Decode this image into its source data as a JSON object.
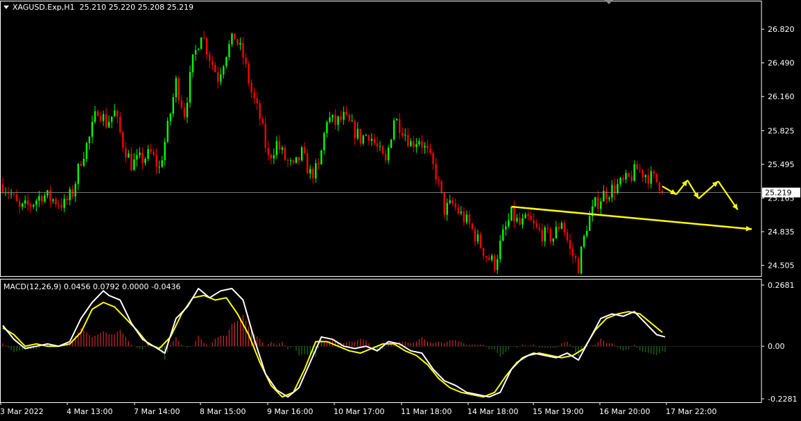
{
  "window": {
    "chart_title": "XAGUSD.Exp,H1",
    "ohlc": "25.210 25.220 25.208 25.219",
    "current_price": "25.219"
  },
  "indicator": {
    "label": "MACD(12,26,9) 0.0456 0.0792 0.0000 -0.0436"
  },
  "colors": {
    "background": "#000000",
    "bull_candle": "#00ff00",
    "bear_candle": "#ff0000",
    "grid_border": "#ffffff",
    "annotation": "#ffff00",
    "macd_line": "#ffffff",
    "signal_line": "#ffff00"
  },
  "chart_data": [
    {
      "type": "candlestick",
      "price_axis_ticks": [
        "26.820",
        "26.490",
        "26.160",
        "25.825",
        "25.495",
        "25.165",
        "24.835",
        "24.505"
      ],
      "time_axis_ticks": [
        "3 Mar 2022",
        "4 Mar 13:00",
        "7 Mar 14:00",
        "8 Mar 15:00",
        "9 Mar 16:00",
        "10 Mar 17:00",
        "11 Mar 18:00",
        "14 Mar 18:00",
        "15 Mar 19:00",
        "16 Mar 20:00",
        "17 Mar 22:00"
      ],
      "current_price": 25.219,
      "ylim": [
        24.4,
        27.1
      ],
      "close_path": [
        [
          0,
          25.3
        ],
        [
          3,
          25.2
        ],
        [
          6,
          25.05
        ],
        [
          10,
          25.1
        ],
        [
          14,
          25.2
        ],
        [
          18,
          25.15
        ],
        [
          22,
          25.1
        ],
        [
          25,
          25.22
        ],
        [
          28,
          25.55
        ],
        [
          31,
          25.75
        ],
        [
          34,
          26.05
        ],
        [
          37,
          25.9
        ],
        [
          40,
          26.0
        ],
        [
          43,
          25.7
        ],
        [
          46,
          25.5
        ],
        [
          50,
          25.55
        ],
        [
          53,
          25.6
        ],
        [
          56,
          25.45
        ],
        [
          59,
          25.85
        ],
        [
          62,
          26.3
        ],
        [
          65,
          26.0
        ],
        [
          68,
          26.5
        ],
        [
          71,
          26.8
        ],
        [
          74,
          26.55
        ],
        [
          77,
          26.35
        ],
        [
          80,
          26.6
        ],
        [
          83,
          26.75
        ],
        [
          86,
          26.55
        ],
        [
          89,
          26.2
        ],
        [
          92,
          25.95
        ],
        [
          95,
          25.55
        ],
        [
          98,
          25.7
        ],
        [
          101,
          25.55
        ],
        [
          104,
          25.45
        ],
        [
          107,
          25.6
        ],
        [
          110,
          25.4
        ],
        [
          113,
          25.45
        ],
        [
          116,
          25.95
        ],
        [
          119,
          25.9
        ],
        [
          122,
          25.95
        ],
        [
          125,
          25.85
        ],
        [
          128,
          25.75
        ],
        [
          131,
          25.8
        ],
        [
          134,
          25.65
        ],
        [
          137,
          25.5
        ],
        [
          140,
          25.95
        ],
        [
          143,
          25.85
        ],
        [
          146,
          25.7
        ],
        [
          149,
          25.75
        ],
        [
          152,
          25.6
        ],
        [
          155,
          25.4
        ],
        [
          158,
          25.05
        ],
        [
          161,
          25.1
        ],
        [
          164,
          25.0
        ],
        [
          167,
          24.9
        ],
        [
          170,
          24.75
        ],
        [
          173,
          24.6
        ],
        [
          176,
          24.52
        ],
        [
          179,
          24.8
        ],
        [
          182,
          25.0
        ],
        [
          185,
          24.9
        ],
        [
          188,
          24.95
        ],
        [
          191,
          24.85
        ],
        [
          194,
          24.8
        ],
        [
          197,
          24.78
        ],
        [
          200,
          24.95
        ],
        [
          203,
          24.65
        ],
        [
          206,
          24.5
        ],
        [
          209,
          24.9
        ],
        [
          212,
          25.1
        ],
        [
          215,
          25.2
        ],
        [
          218,
          25.25
        ],
        [
          221,
          25.3
        ],
        [
          224,
          25.35
        ],
        [
          227,
          25.45
        ],
        [
          230,
          25.4
        ],
        [
          233,
          25.35
        ],
        [
          236,
          25.28
        ]
      ],
      "annotations": {
        "trend_line": {
          "from": [
            182,
            25.08
          ],
          "to": [
            268,
            24.86
          ]
        },
        "zigzag_forecast": [
          [
            236,
            25.28
          ],
          [
            241,
            25.2
          ],
          [
            245,
            25.34
          ],
          [
            249,
            25.16
          ],
          [
            256,
            25.33
          ],
          [
            263,
            25.05
          ]
        ]
      }
    },
    {
      "type": "macd",
      "params": [
        12,
        26,
        9
      ],
      "values": {
        "macd": 0.0456,
        "signal": 0.0792,
        "histogram": 0.0,
        "diff": -0.0436
      },
      "axis_ticks": [
        "0.2681",
        "0.00",
        "-0.2281"
      ],
      "ylim": [
        -0.2281,
        0.2681
      ],
      "macd_line": [
        [
          0,
          0.09
        ],
        [
          4,
          0.03
        ],
        [
          8,
          -0.01
        ],
        [
          12,
          0.0
        ],
        [
          16,
          0.01
        ],
        [
          20,
          0.0
        ],
        [
          24,
          0.02
        ],
        [
          28,
          0.12
        ],
        [
          32,
          0.19
        ],
        [
          36,
          0.24
        ],
        [
          38,
          0.22
        ],
        [
          42,
          0.2
        ],
        [
          46,
          0.1
        ],
        [
          50,
          0.03
        ],
        [
          54,
          0.0
        ],
        [
          58,
          -0.03
        ],
        [
          62,
          0.12
        ],
        [
          66,
          0.17
        ],
        [
          70,
          0.25
        ],
        [
          74,
          0.21
        ],
        [
          78,
          0.24
        ],
        [
          82,
          0.25
        ],
        [
          86,
          0.2
        ],
        [
          90,
          0.03
        ],
        [
          94,
          -0.12
        ],
        [
          98,
          -0.19
        ],
        [
          102,
          -0.22
        ],
        [
          106,
          -0.18
        ],
        [
          110,
          -0.07
        ],
        [
          114,
          0.04
        ],
        [
          118,
          0.03
        ],
        [
          122,
          0.0
        ],
        [
          126,
          -0.01
        ],
        [
          130,
          0.0
        ],
        [
          134,
          -0.02
        ],
        [
          138,
          0.02
        ],
        [
          142,
          0.01
        ],
        [
          146,
          -0.02
        ],
        [
          150,
          -0.03
        ],
        [
          154,
          -0.1
        ],
        [
          158,
          -0.15
        ],
        [
          162,
          -0.17
        ],
        [
          166,
          -0.2
        ],
        [
          170,
          -0.21
        ],
        [
          174,
          -0.22
        ],
        [
          178,
          -0.2
        ],
        [
          182,
          -0.1
        ],
        [
          186,
          -0.05
        ],
        [
          190,
          -0.03
        ],
        [
          194,
          -0.04
        ],
        [
          198,
          -0.05
        ],
        [
          202,
          -0.03
        ],
        [
          206,
          -0.06
        ],
        [
          210,
          0.03
        ],
        [
          214,
          0.12
        ],
        [
          218,
          0.14
        ],
        [
          222,
          0.13
        ],
        [
          226,
          0.15
        ],
        [
          230,
          0.1
        ],
        [
          234,
          0.05
        ],
        [
          237,
          0.04
        ]
      ],
      "signal_line": [
        [
          0,
          0.08
        ],
        [
          4,
          0.05
        ],
        [
          8,
          0.0
        ],
        [
          12,
          0.01
        ],
        [
          16,
          0.0
        ],
        [
          20,
          0.0
        ],
        [
          24,
          0.01
        ],
        [
          28,
          0.06
        ],
        [
          32,
          0.16
        ],
        [
          36,
          0.19
        ],
        [
          40,
          0.17
        ],
        [
          44,
          0.12
        ],
        [
          48,
          0.07
        ],
        [
          52,
          0.01
        ],
        [
          56,
          -0.01
        ],
        [
          60,
          0.04
        ],
        [
          64,
          0.14
        ],
        [
          68,
          0.21
        ],
        [
          72,
          0.22
        ],
        [
          76,
          0.2
        ],
        [
          80,
          0.21
        ],
        [
          84,
          0.14
        ],
        [
          88,
          0.05
        ],
        [
          92,
          -0.07
        ],
        [
          96,
          -0.17
        ],
        [
          100,
          -0.22
        ],
        [
          104,
          -0.2
        ],
        [
          108,
          -0.1
        ],
        [
          112,
          0.02
        ],
        [
          116,
          0.02
        ],
        [
          120,
          0.0
        ],
        [
          124,
          -0.02
        ],
        [
          128,
          -0.03
        ],
        [
          132,
          -0.01
        ],
        [
          136,
          0.01
        ],
        [
          140,
          0.01
        ],
        [
          144,
          -0.02
        ],
        [
          148,
          -0.04
        ],
        [
          152,
          -0.08
        ],
        [
          156,
          -0.14
        ],
        [
          160,
          -0.18
        ],
        [
          164,
          -0.2
        ],
        [
          168,
          -0.21
        ],
        [
          172,
          -0.22
        ],
        [
          176,
          -0.2
        ],
        [
          180,
          -0.13
        ],
        [
          184,
          -0.07
        ],
        [
          188,
          -0.04
        ],
        [
          192,
          -0.03
        ],
        [
          196,
          -0.04
        ],
        [
          200,
          -0.05
        ],
        [
          204,
          -0.04
        ],
        [
          208,
          -0.01
        ],
        [
          212,
          0.07
        ],
        [
          216,
          0.12
        ],
        [
          220,
          0.14
        ],
        [
          224,
          0.15
        ],
        [
          228,
          0.14
        ],
        [
          232,
          0.1
        ],
        [
          236,
          0.06
        ]
      ]
    }
  ]
}
